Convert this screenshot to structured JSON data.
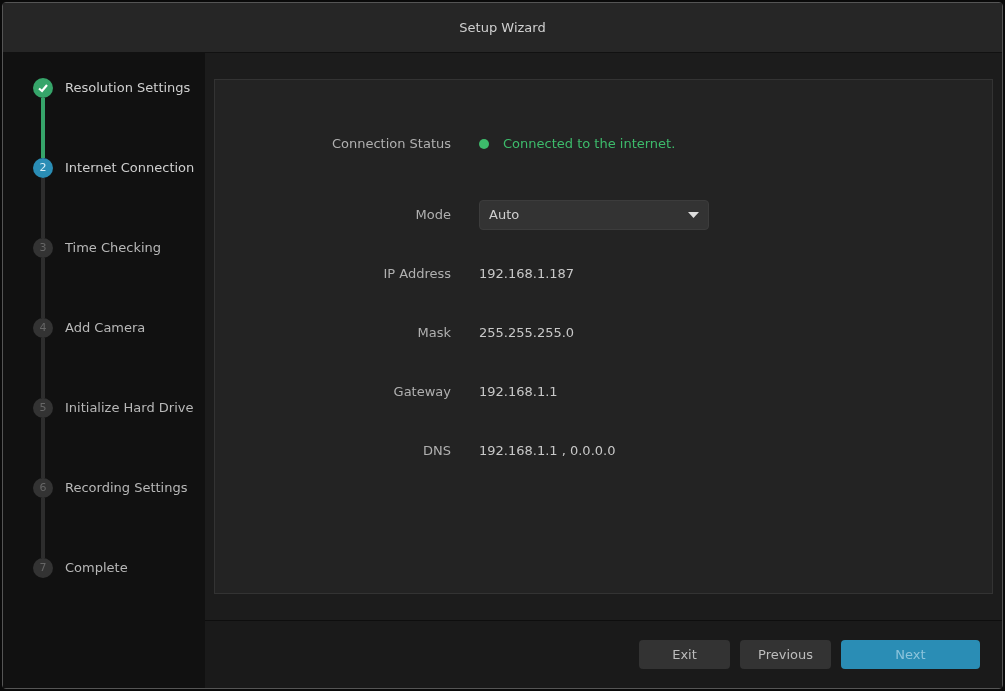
{
  "window": {
    "title": "Setup Wizard"
  },
  "steps": [
    {
      "kind": "done",
      "label": "Resolution Settings"
    },
    {
      "kind": "current",
      "number": "2",
      "label": "Internet Connection"
    },
    {
      "kind": "pending",
      "number": "3",
      "label": "Time Checking"
    },
    {
      "kind": "pending",
      "number": "4",
      "label": "Add Camera"
    },
    {
      "kind": "pending",
      "number": "5",
      "label": "Initialize Hard Drive"
    },
    {
      "kind": "pending",
      "number": "6",
      "label": "Recording Settings"
    },
    {
      "kind": "pending",
      "number": "7",
      "label": "Complete"
    }
  ],
  "form": [
    {
      "kind": "status",
      "label": "Connection Status",
      "value": "Connected to the internet.",
      "color": "#3dbb6b"
    },
    {
      "kind": "dropdown",
      "label": "Mode",
      "value": "Auto"
    },
    {
      "kind": "text",
      "label": "IP Address",
      "value": "192.168.1.187"
    },
    {
      "kind": "text",
      "label": "Mask",
      "value": "255.255.255.0"
    },
    {
      "kind": "text",
      "label": "Gateway",
      "value": "192.168.1.1"
    },
    {
      "kind": "text",
      "label": "DNS",
      "value": "192.168.1.1 , 0.0.0.0"
    }
  ],
  "buttons": [
    {
      "label": "Exit",
      "primary": false
    },
    {
      "label": "Previous",
      "primary": false
    },
    {
      "label": "Next",
      "primary": true
    }
  ]
}
